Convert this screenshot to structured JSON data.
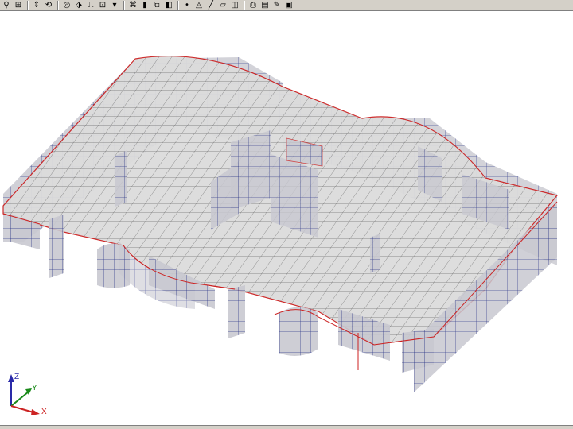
{
  "toolbar": {
    "buttons": [
      {
        "name": "zoom-in-icon",
        "glyph": "⚲"
      },
      {
        "name": "zoom-window-icon",
        "glyph": "⊞"
      },
      {
        "name": "sep"
      },
      {
        "name": "pan-icon",
        "glyph": "⇕"
      },
      {
        "name": "rotate-icon",
        "glyph": "⟲"
      },
      {
        "name": "sep"
      },
      {
        "name": "view-3d-icon",
        "glyph": "◎"
      },
      {
        "name": "view-plan-icon",
        "glyph": "⬗"
      },
      {
        "name": "view-elevation-icon",
        "glyph": "⎍"
      },
      {
        "name": "view-options-icon",
        "glyph": "⊡"
      },
      {
        "name": "dropdown-arrow-icon",
        "glyph": "▾"
      },
      {
        "name": "sep"
      },
      {
        "name": "draw-frame-icon",
        "glyph": "⌘"
      },
      {
        "name": "extrude-icon",
        "glyph": "▮"
      },
      {
        "name": "layers-icon",
        "glyph": "⧉"
      },
      {
        "name": "shell-icon",
        "glyph": "◧"
      },
      {
        "name": "sep"
      },
      {
        "name": "point-icon",
        "glyph": "•"
      },
      {
        "name": "mesh-icon",
        "glyph": "◬"
      },
      {
        "name": "line-icon",
        "glyph": "╱"
      },
      {
        "name": "area-icon",
        "glyph": "▱"
      },
      {
        "name": "solid-icon",
        "glyph": "◫"
      },
      {
        "name": "sep"
      },
      {
        "name": "print-icon",
        "glyph": "⎙"
      },
      {
        "name": "report-icon",
        "glyph": "▤"
      },
      {
        "name": "analysis-icon",
        "glyph": "✎"
      },
      {
        "name": "run-icon",
        "glyph": "▣"
      }
    ]
  },
  "axes": {
    "x": "X",
    "y": "Y",
    "z": "Z"
  },
  "colors": {
    "edge": "#cc2222",
    "mesh": "#1f2a80",
    "wall": "#c9c9d1",
    "slab": "#dcdcdc",
    "background": "#ffffff"
  }
}
